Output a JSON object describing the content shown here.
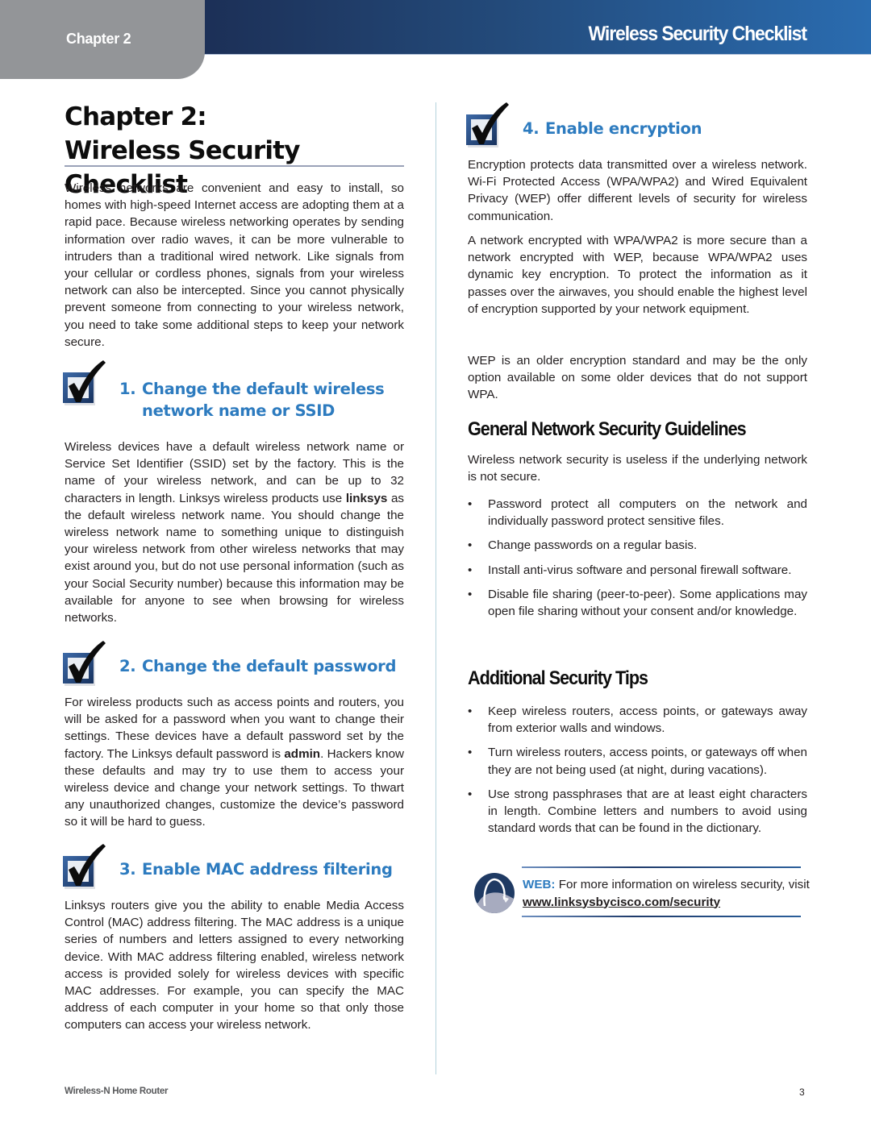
{
  "header": {
    "chapter_tab": "Chapter 2",
    "section_title": "Wireless Security Checklist",
    "colors": {
      "tab": "#939598",
      "bar_start": "#1c2f56",
      "bar_end": "#2a6cb0"
    }
  },
  "page": {
    "chapter_line1": "Chapter 2:",
    "chapter_line2": "Wireless Security Checklist",
    "intro": "Wireless networks are convenient and easy to install, so homes with high-speed Internet access are adopting them at a rapid pace. Because wireless networking operates by sending information over radio waves, it can be more vulnerable to intruders than a traditional wired network. Like signals from your cellular or cordless phones, signals from your wireless network can also be intercepted. Since you cannot physically prevent someone from connecting to your wireless network, you need to take some additional steps to keep your network secure."
  },
  "sections": [
    {
      "number": "1.",
      "title_line1": "Change the default wireless",
      "title_line2": "network name or SSID",
      "body_before": "Wireless devices have a default wireless network name or Service Set Identifier (SSID) set by the factory. This is the name of your wireless network, and can be up to 32 characters in length. Linksys wireless products use ",
      "body_bold": "linksys",
      "body_after": " as the default wireless network name. You should change the wireless network name to something unique to distinguish your wireless network from other wireless networks that may exist around you, but do not use personal information (such as your Social Security number) because this information may be available for anyone to see when browsing for wireless networks."
    },
    {
      "number": "2.",
      "title": "Change the default password",
      "body_before": "For wireless products such as access points and routers, you will be asked for a password when you want to change their settings. These devices have a default password set by the factory. The Linksys default password is ",
      "body_bold": "admin",
      "body_after": ". Hackers know these defaults and may try to use them to access your wireless device and change your network settings. To thwart any unauthorized changes, customize the device’s password so it will be hard to guess."
    },
    {
      "number": "3.",
      "title": "Enable MAC address filtering",
      "body": "Linksys routers give you the ability to enable Media Access Control (MAC) address filtering. The MAC address is a unique series of numbers and letters assigned to every networking device. With MAC address filtering enabled, wireless network access is provided solely for wireless devices with specific MAC addresses. For example, you can specify the MAC address of each computer in your home so that only those computers can access your wireless network."
    },
    {
      "number": "4.",
      "title": "Enable encryption",
      "paragraphs": [
        "Encryption protects data transmitted over a wireless network. Wi-Fi Protected Access (WPA/WPA2) and Wired Equivalent Privacy (WEP) offer different levels of security for wireless communication.",
        "A network encrypted with WPA/WPA2 is more secure than a network encrypted with WEP, because WPA/WPA2 uses dynamic key encryption. To protect the information as it passes over the airwaves, you should enable the highest level of encryption supported by your network equipment.",
        "WEP is an older encryption standard and may be the only option available on some older devices that do not support WPA."
      ]
    }
  ],
  "general": {
    "heading": "General Network Security Guidelines",
    "intro": "Wireless network security is useless if the underlying network is not secure.",
    "bullets": [
      "Password protect all computers on the network and individually password protect sensitive files.",
      "Change passwords on a regular basis.",
      "Install anti-virus software and personal firewall software.",
      "Disable file sharing (peer-to-peer). Some applications may open file sharing without your consent and/or knowledge."
    ]
  },
  "additional": {
    "heading": "Additional Security Tips",
    "bullets": [
      "Keep wireless routers, access points, or gateways away from exterior walls and windows.",
      "Turn wireless routers, access points, or gateways off when they are not being used (at night, during vacations).",
      "Use strong passphrases that are at least eight characters in length. Combine letters and numbers to avoid using standard words that can be found in the dictionary."
    ]
  },
  "web_note": {
    "icon": "web-globe-icon",
    "label": "WEB:",
    "text": " For more information on wireless security, visit ",
    "link": "www.linksysbycisco.com/security",
    "label_color": "#2d7bbf"
  },
  "footer": {
    "product": "Wireless-N Home Router",
    "page_number": "3"
  },
  "colors": {
    "heading_blue": "#2d7bbf",
    "body_text": "#231f20",
    "divider": "#b4d2dc"
  }
}
